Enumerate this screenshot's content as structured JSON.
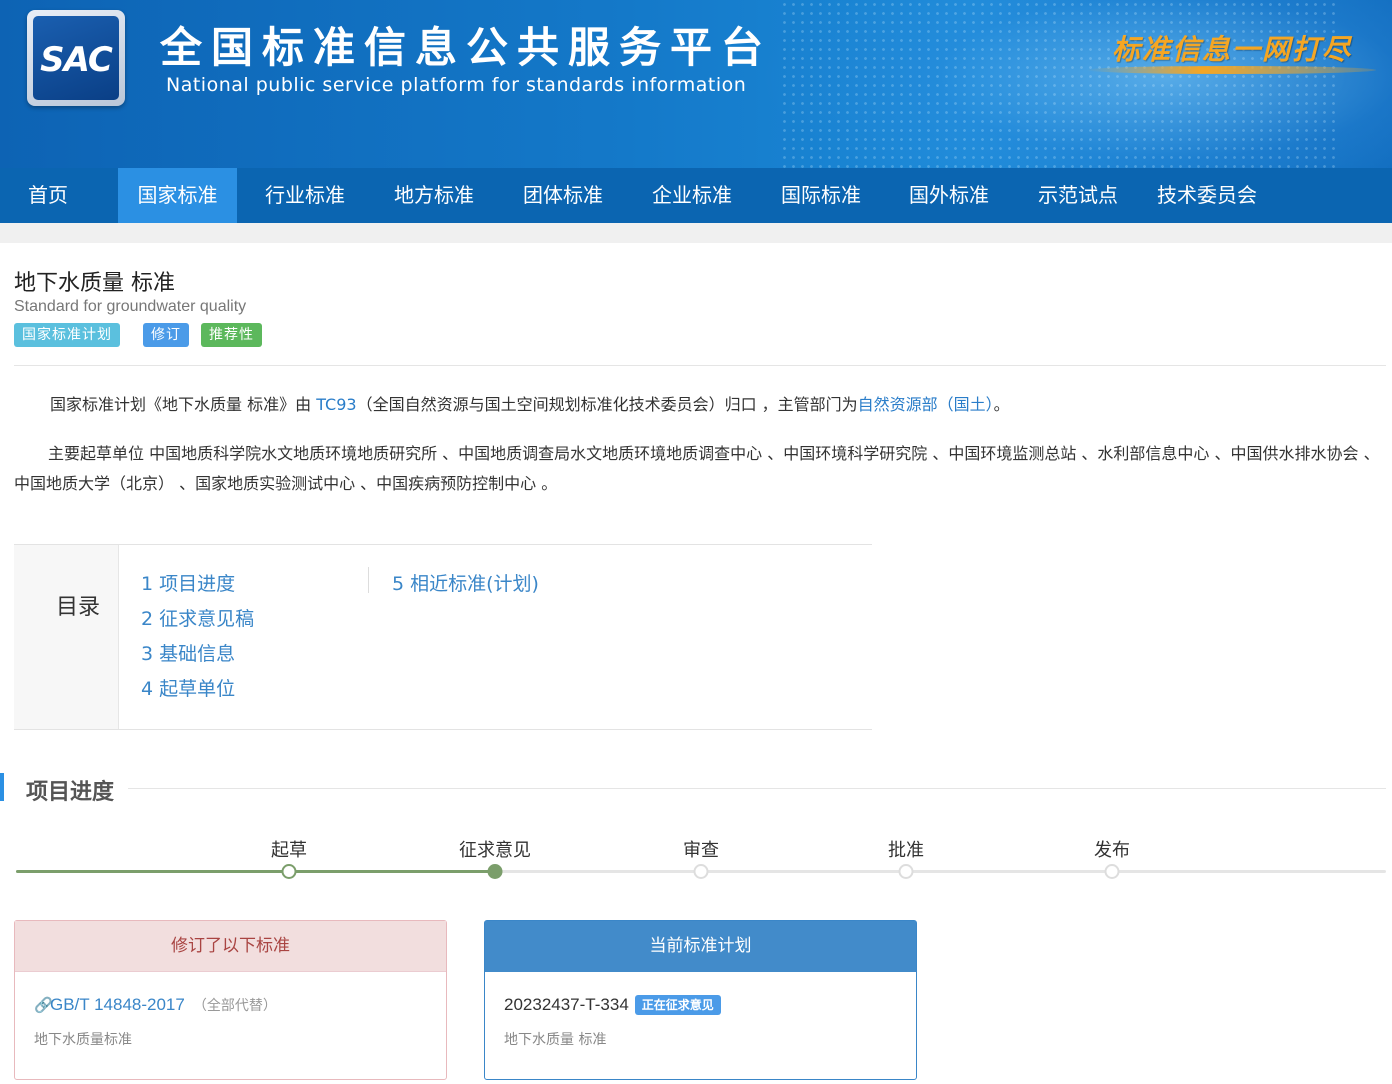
{
  "banner": {
    "logo_text": "SAC",
    "title": "全国标准信息公共服务平台",
    "subtitle": "National public service platform  for standards information",
    "slogan": "标准信息一网打尽"
  },
  "nav": {
    "items": [
      "首页",
      "国家标准",
      "行业标准",
      "地方标准",
      "团体标准",
      "企业标准",
      "国际标准",
      "国外标准",
      "示范试点",
      "技术委员会"
    ],
    "active": "国家标准"
  },
  "standard": {
    "title": "地下水质量 标准",
    "english_title": "Standard for groundwater quality",
    "tags": [
      "国家标准计划",
      "修订",
      "推荐性"
    ]
  },
  "description": {
    "p1_prefix": "国家标准计划《地下水质量 标准》由 ",
    "p1_tc": "TC93",
    "p1_middle": "（全国自然资源与国土空间规划标准化技术委员会）归口 ，主管部门为",
    "p1_dept": "自然资源部（国土）",
    "p1_suffix": "。",
    "p2": "主要起草单位 中国地质科学院水文地质环境地质研究所 、中国地质调查局水文地质环境地质调查中心 、中国环境科学研究院 、中国环境监测总站 、水利部信息中心 、中国供水排水协会 、中国地质大学（北京） 、国家地质实验测试中心 、中国疾病预防控制中心 。"
  },
  "toc": {
    "label": "目录",
    "items": [
      "1  项目进度",
      "2  征求意见稿",
      "3  基础信息",
      "4  起草单位",
      "5  相近标准(计划)"
    ]
  },
  "progress": {
    "section_title": "项目进度",
    "steps": [
      "起草",
      "征求意见",
      "审查",
      "批准",
      "发布"
    ],
    "current_step_index": 1,
    "done_color": "#7b9e6b"
  },
  "cards": {
    "replaced": {
      "header": "修订了以下标准",
      "code": "GB/T 14848-2017",
      "note": "（全部代替）",
      "name": "地下水质量标准"
    },
    "current": {
      "header": "当前标准计划",
      "code": "20232437-T-334",
      "status": "正在征求意见",
      "name": "地下水质量 标准"
    }
  },
  "colors": {
    "nav_bg": "#0b65b1",
    "nav_active": "#2b90e3",
    "link": "#2a7dc9"
  }
}
